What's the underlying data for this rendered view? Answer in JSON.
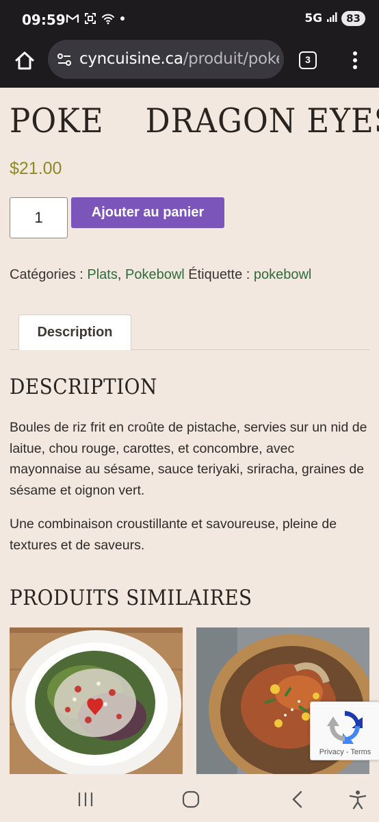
{
  "status_bar": {
    "time": "09:59",
    "network": "5G",
    "battery": "83"
  },
  "browser": {
    "url_domain": "cyncuisine.ca",
    "url_path": "/produit/poke-",
    "tab_count": "3"
  },
  "product": {
    "title": "POKE    DRAGON EYES",
    "price": "$21.00",
    "quantity": "1",
    "add_to_cart": "Ajouter au panier",
    "categories_label": "Catégories : ",
    "categories": [
      "Plats",
      "Pokebowl"
    ],
    "category_sep": ", ",
    "tag_label": " Étiquette : ",
    "tag": "pokebowl"
  },
  "tabs": {
    "description": "Description"
  },
  "description": {
    "heading": "DESCRIPTION",
    "paragraph1": "Boules de riz frit en croûte de pistache, servies sur un nid de laitue, chou rouge, carottes, et concombre, avec mayonnaise au sésame, sauce teriyaki, sriracha, graines de sésame et oignon vert.",
    "paragraph2": "Une combinaison croustillante et savoureuse, pleine de textures et de saveurs."
  },
  "similar": {
    "heading": "PRODUITS SIMILAIRES"
  },
  "recaptcha": {
    "privacy": "Privacy",
    "separator": " - ",
    "terms": "Terms"
  },
  "colors": {
    "background": "#f3e8e0",
    "price": "#8c8a24",
    "link": "#2f6b3a",
    "button": "#7b55b9",
    "chrome": "#1d1b1e"
  }
}
